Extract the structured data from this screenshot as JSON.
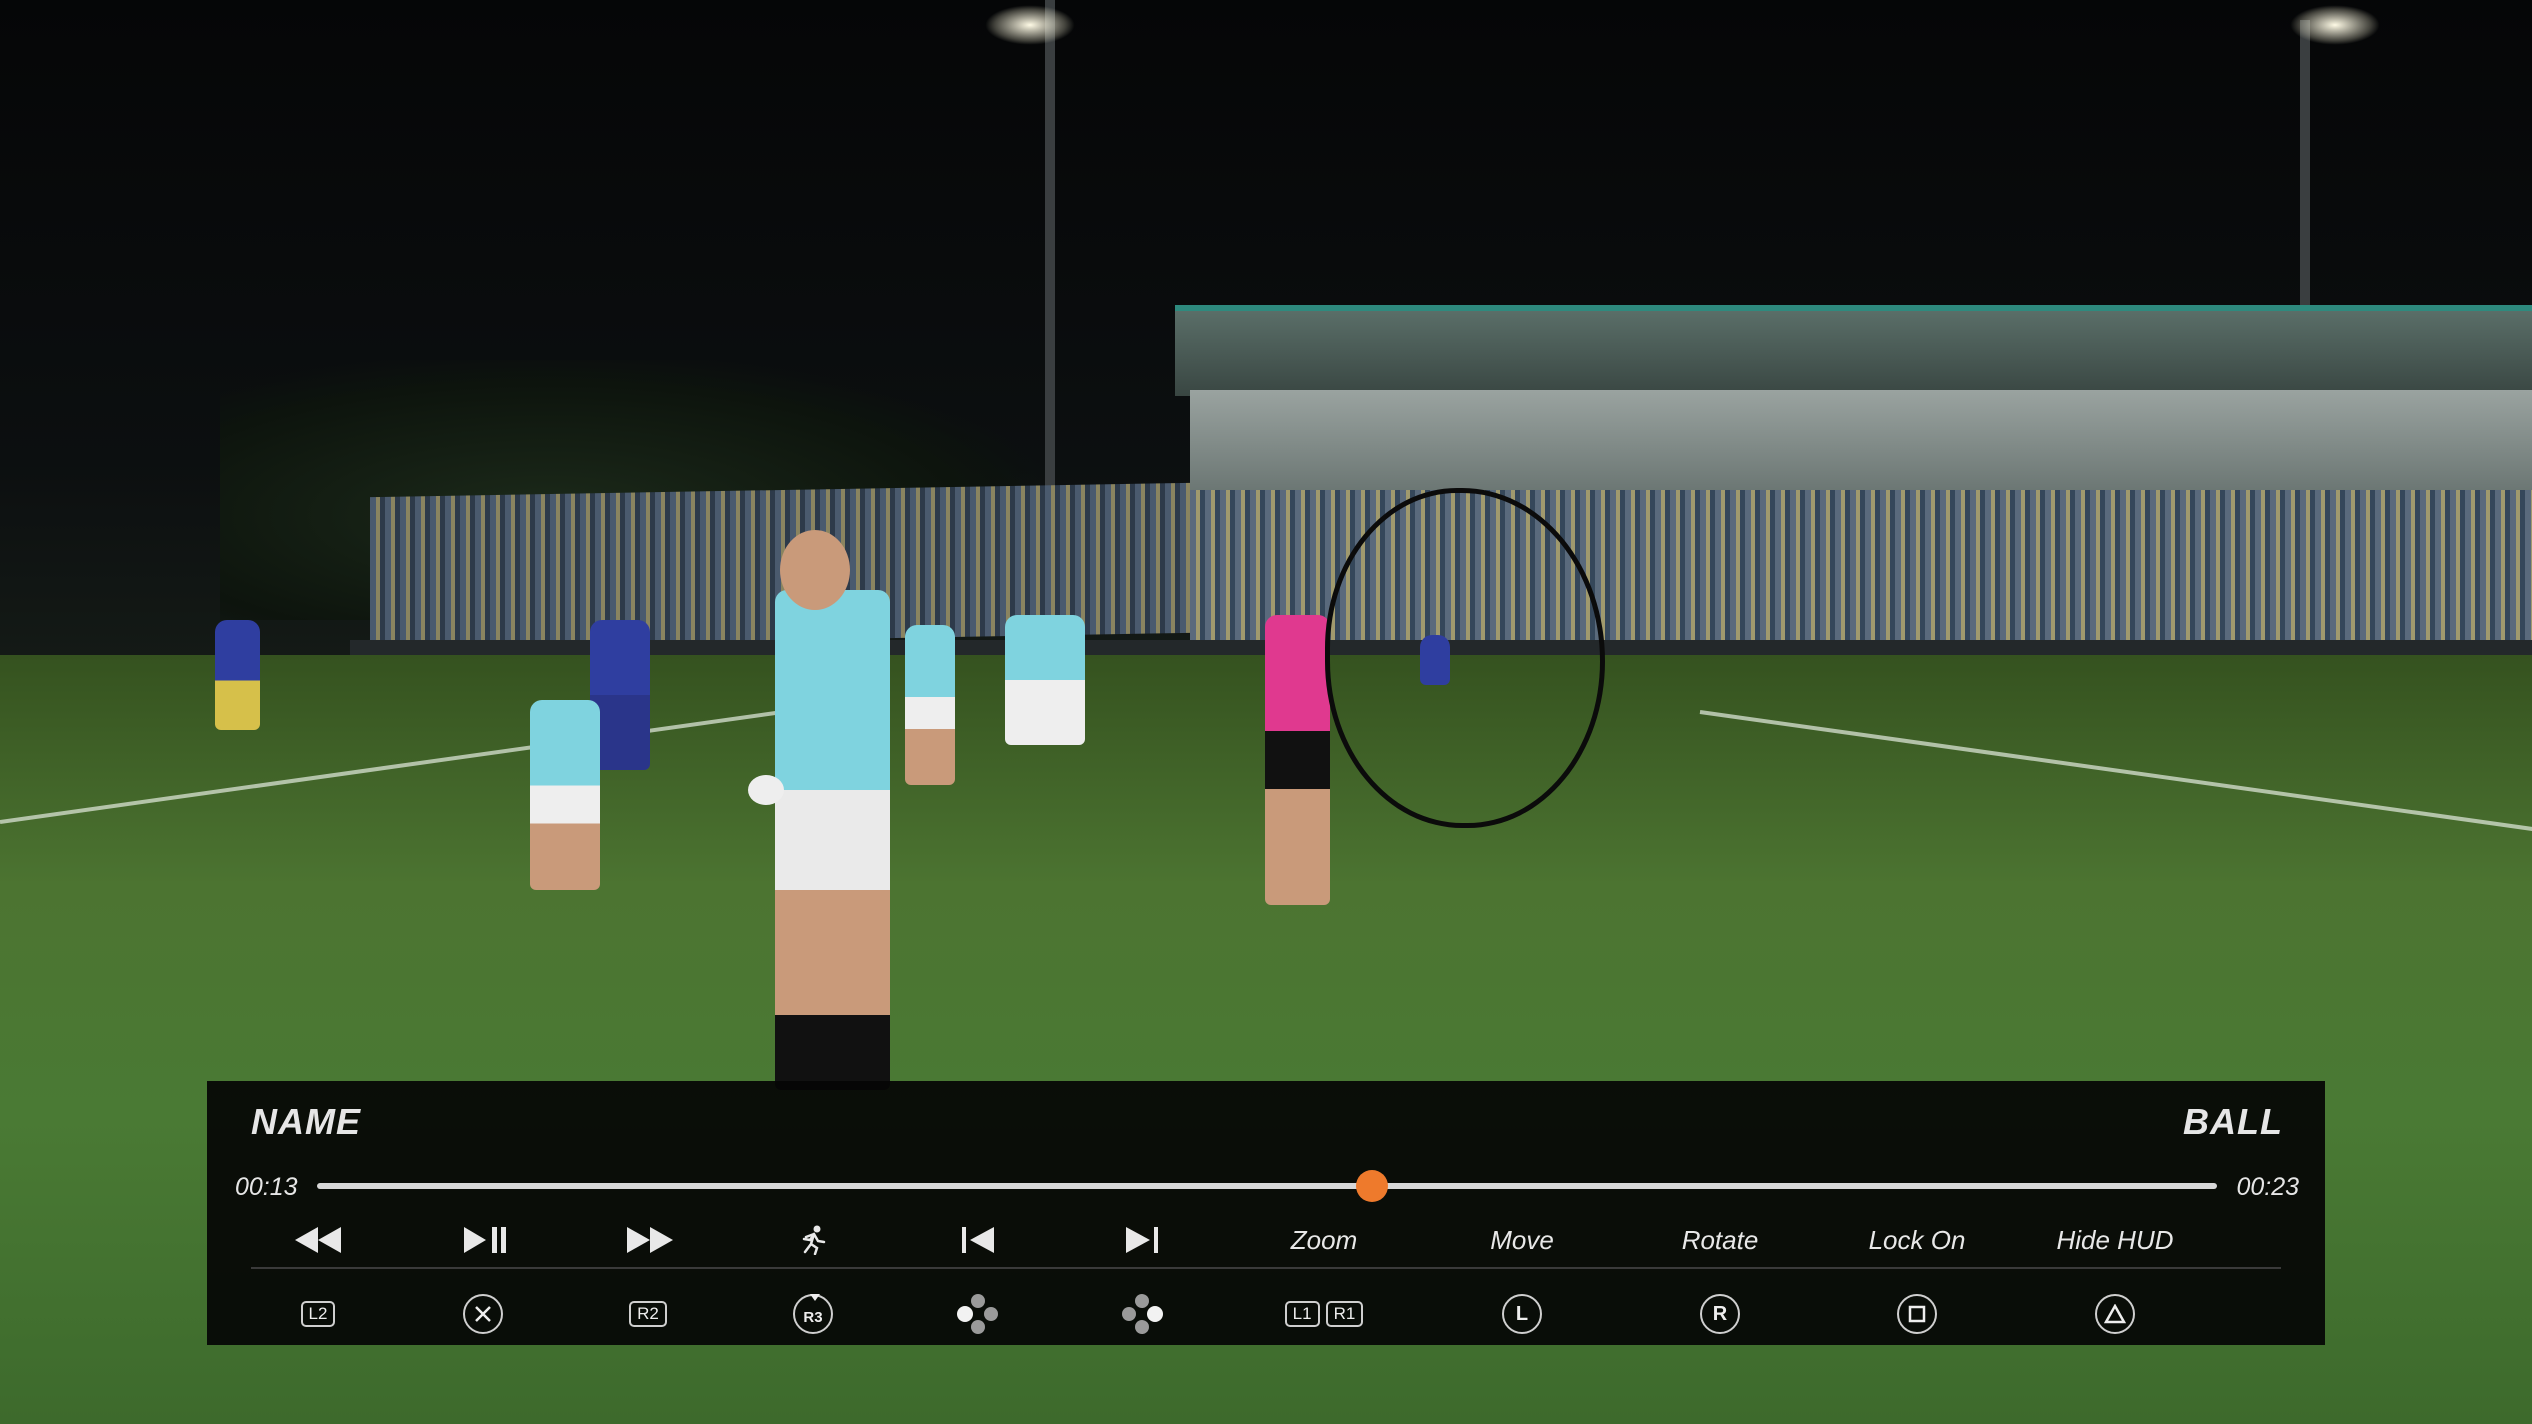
{
  "hud": {
    "name_label": "NAME",
    "ball_label": "BALL",
    "time_current": "00:13",
    "time_total": "00:23",
    "progress": 0.555,
    "accent_color": "#ee7a2c",
    "controls": [
      {
        "id": "rewind",
        "icon": "rewind-icon",
        "button": "L2"
      },
      {
        "id": "play-pause",
        "icon": "play-pause-icon",
        "button": "cross-icon"
      },
      {
        "id": "fast-forward",
        "icon": "fast-forward-icon",
        "button": "R2"
      },
      {
        "id": "player-cam",
        "icon": "running-player-icon",
        "button": "R3"
      },
      {
        "id": "skip-back",
        "icon": "skip-back-icon",
        "button": "dpad-left-icon"
      },
      {
        "id": "skip-forward",
        "icon": "skip-forward-icon",
        "button": "dpad-right-icon"
      }
    ],
    "zoom_label": "Zoom",
    "move_label": "Move",
    "rotate_label": "Rotate",
    "lockon_label": "Lock On",
    "hidehud_label": "Hide HUD",
    "buttons": {
      "l2": "L2",
      "r2": "R2",
      "r3": "R3",
      "l1": "L1",
      "r1": "R1",
      "move_stick": "L",
      "rotate_stick": "R"
    }
  }
}
